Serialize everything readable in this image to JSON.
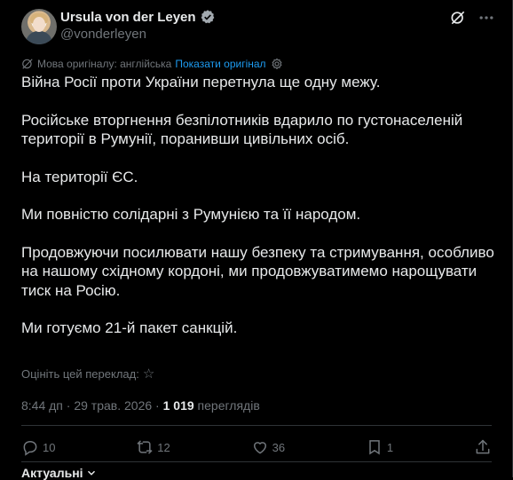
{
  "author": {
    "name": "Ursula von der Leyen",
    "handle": "@vonderleyen"
  },
  "translation_bar": {
    "label": "Мова оригіналу: англійська",
    "show_original": "Показати оригінал"
  },
  "tweet": {
    "paragraphs": [
      "Війна Росії проти України перетнула ще одну межу.",
      "Російське вторгнення безпілотників вдарило по густонаселеній території в Румунії, поранивши цивільних осіб.",
      "На території ЄС.",
      "Ми повністю солідарні з Румунією та її народом.",
      "Продовжуючи посилювати нашу безпеку та стримування, особливо на нашому східному кордоні, ми продовжуватимемо нарощувати тиск на Росію.",
      "Ми готуємо 21-й пакет санкцій."
    ]
  },
  "rate_translation": {
    "label": "Оцініть цей переклад:"
  },
  "meta": {
    "time": "8:44 дп",
    "date": "29 трав. 2026",
    "separator": "·",
    "views_count": "1 019",
    "views_label": "переглядів"
  },
  "actions": {
    "replies": "10",
    "reposts": "12",
    "likes": "36",
    "bookmarks": "1"
  },
  "sort": {
    "label": "Актуальні"
  },
  "icons": {
    "verified": "verified-badge-icon",
    "grok": "grok-icon",
    "more": "more-icon",
    "translate": "translate-icon",
    "settings": "gear-icon",
    "star": "star-icon",
    "reply": "reply-icon",
    "repost": "repost-icon",
    "like": "heart-icon",
    "bookmark": "bookmark-icon",
    "share": "share-icon",
    "chevron": "chevron-down-icon"
  },
  "colors": {
    "background": "#000000",
    "text": "#e7e9ea",
    "muted": "#71767b",
    "accent": "#1d9bf0",
    "divider": "#2f3336"
  }
}
